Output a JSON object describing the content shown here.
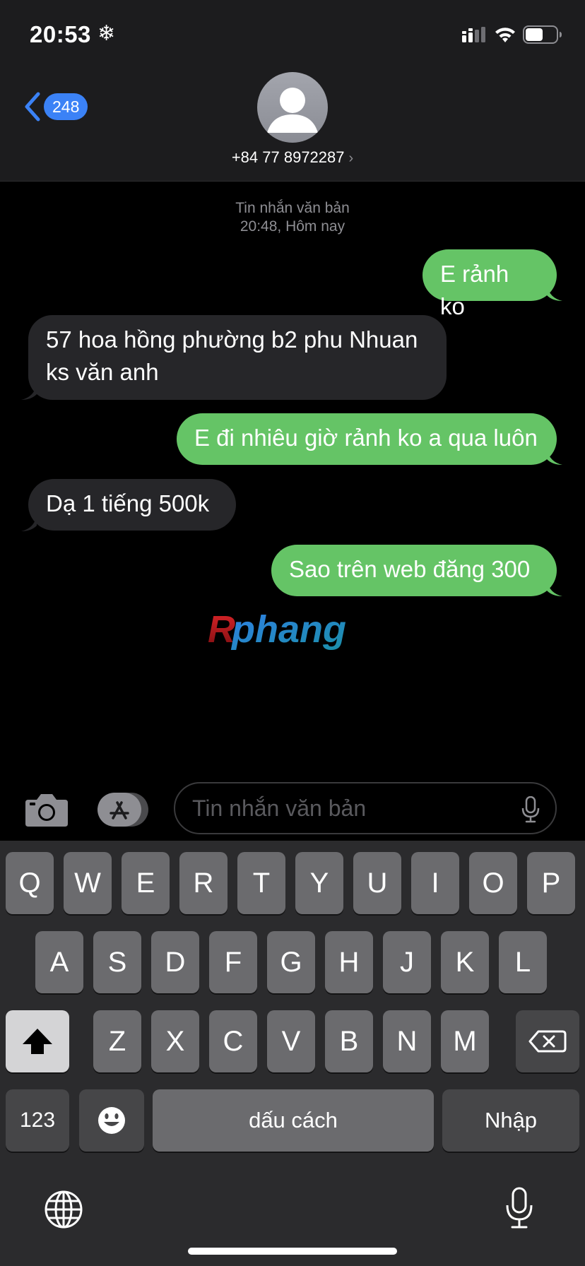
{
  "status_bar": {
    "time": "20:53",
    "indicator_icon": "snowflake-icon"
  },
  "header": {
    "back_count": "248",
    "contact": "+84 77 8972287"
  },
  "conversation": {
    "service": "Tin nhắn văn bản",
    "timestamp": "20:48, Hôm nay",
    "messages": [
      {
        "from": "me",
        "lines": [
          "E rảnh ko"
        ]
      },
      {
        "from": "them",
        "lines": [
          "57 hoa hồng phường b2 phu Nhuan",
          "ks văn anh"
        ]
      },
      {
        "from": "me",
        "lines": [
          "E đi nhiêu giờ rảnh ko a qua luôn"
        ]
      },
      {
        "from": "them",
        "lines": [
          "Dạ 1 tiếng 500k"
        ]
      },
      {
        "from": "me",
        "lines": [
          "Sao trên web đăng 300"
        ]
      }
    ],
    "watermark": "Rphang"
  },
  "compose": {
    "placeholder": "Tin nhắn văn bản"
  },
  "keyboard": {
    "row1": [
      "Q",
      "W",
      "E",
      "R",
      "T",
      "Y",
      "U",
      "I",
      "O",
      "P"
    ],
    "row2": [
      "A",
      "S",
      "D",
      "F",
      "G",
      "H",
      "J",
      "K",
      "L"
    ],
    "row3": [
      "Z",
      "X",
      "C",
      "V",
      "B",
      "N",
      "M"
    ],
    "numbers_label": "123",
    "space_label": "dấu cách",
    "return_label": "Nhập"
  },
  "colors": {
    "outgoing_bubble": "#65c466",
    "incoming_bubble": "#262629",
    "accent": "#3b82f6"
  }
}
